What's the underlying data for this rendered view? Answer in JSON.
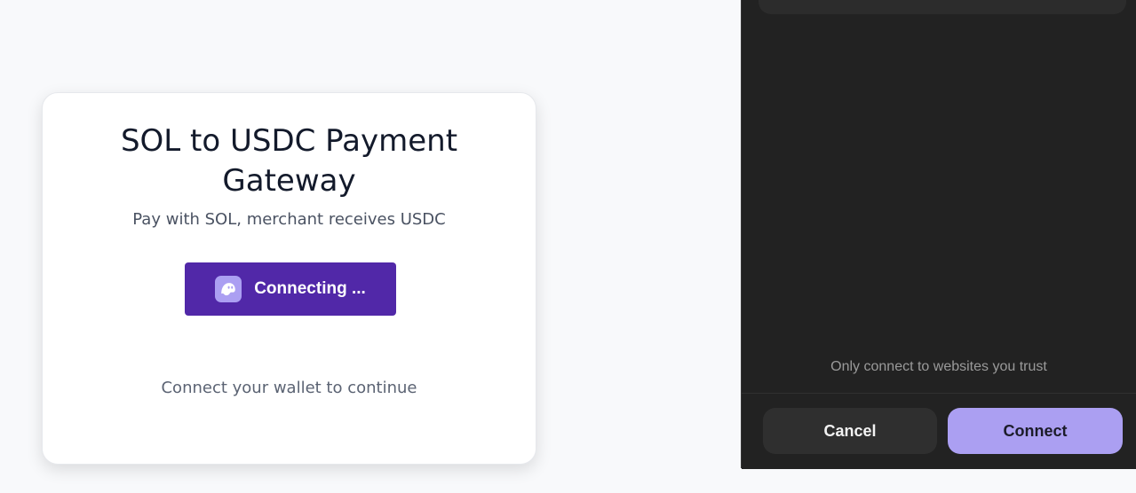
{
  "card": {
    "title": "SOL to USDC Payment Gateway",
    "subtitle": "Pay with SOL, merchant receives USDC",
    "connect_button_label": "Connecting ...",
    "wallet_icon": "phantom-ghost-icon",
    "hint": "Connect your wallet to continue"
  },
  "wallet_popup": {
    "trust_note": "Only connect to websites you trust",
    "cancel_label": "Cancel",
    "connect_label": "Connect"
  },
  "colors": {
    "page_background": "#f8f9fb",
    "button_primary": "#5128a8",
    "wallet_accent": "#ab9ff2",
    "popup_background": "#222222",
    "title_text": "#131a2b"
  }
}
